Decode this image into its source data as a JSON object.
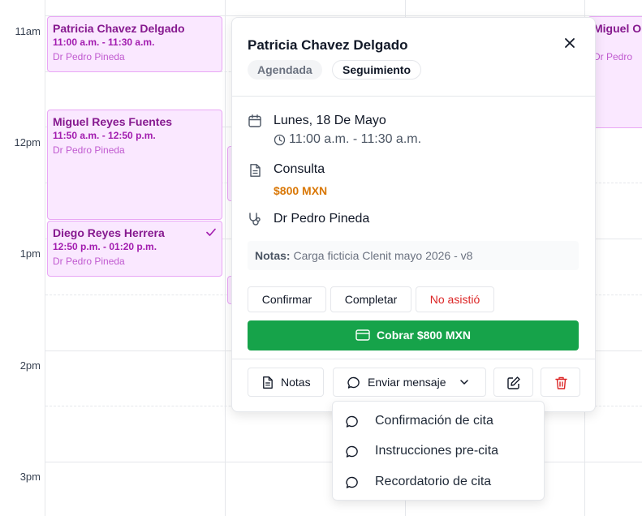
{
  "calendar": {
    "hours": [
      "11am",
      "12pm",
      "1pm",
      "2pm",
      "3pm"
    ],
    "events": [
      {
        "name": "Patricia Chavez Delgado",
        "time": "11:00 a.m. - 11:30 a.m.",
        "doctor": "Dr Pedro Pineda"
      },
      {
        "name": "Miguel Reyes Fuentes",
        "time": "11:50 a.m. - 12:50 p.m.",
        "doctor": "Dr Pedro Pineda"
      },
      {
        "name": "Diego Reyes Herrera",
        "time": "12:50 p.m. - 01:20 p.m.",
        "doctor": "Dr Pedro Pineda",
        "confirmed": true
      },
      {
        "name": "Miguel O",
        "doctor": "Dr Pedro"
      }
    ]
  },
  "popup": {
    "title": "Patricia Chavez Delgado",
    "status_chip": "Agendada",
    "type_chip": "Seguimiento",
    "date": "Lunes, 18 De Mayo",
    "time": "11:00 a.m. - 11:30 a.m.",
    "service": "Consulta",
    "price": "$800 MXN",
    "doctor": "Dr Pedro Pineda",
    "notes_label": "Notas:",
    "notes_text": "Carga ficticia Clenit mayo 2026 - v8",
    "actions": {
      "confirm": "Confirmar",
      "complete": "Completar",
      "no_show": "No asistió"
    },
    "pay_label": "Cobrar $800 MXN",
    "footer": {
      "notes": "Notas",
      "send_message": "Enviar mensaje"
    }
  },
  "dropdown": {
    "items": [
      "Confirmación de cita",
      "Instrucciones pre-cita",
      "Recordatorio de cita"
    ]
  },
  "colors": {
    "event_bg": "#fae8ff",
    "event_text": "#86198f",
    "pay_green": "#16a34a",
    "price_orange": "#d97706",
    "danger_red": "#dc2626"
  }
}
